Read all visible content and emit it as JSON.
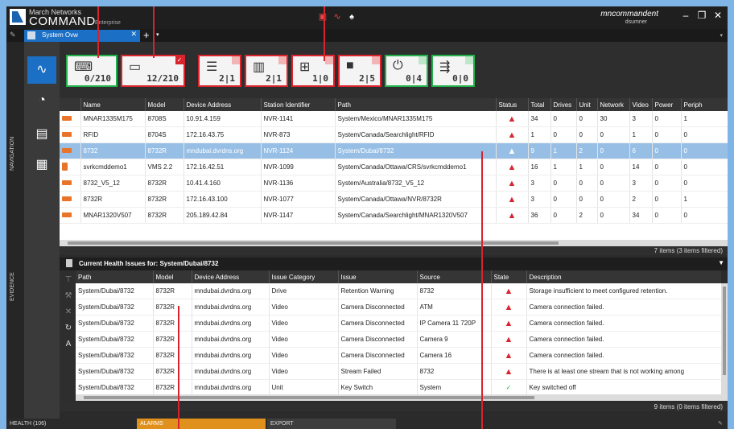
{
  "app": {
    "brand_line1": "March Networks",
    "brand_line2": "COMMAND",
    "brand_line3": "Enterprise",
    "user_name": "mncommandent",
    "user_login": "dsumner"
  },
  "tabs": [
    {
      "label": "System Ovw"
    }
  ],
  "side": {
    "navigation_label": "NAVIGATION",
    "evidence_label": "EVIDENCE"
  },
  "tiles": [
    {
      "icon": "network-icon",
      "count": "0/210",
      "status": "ok"
    },
    {
      "icon": "recorder-icon",
      "count": "12/210",
      "status": "alert",
      "checked": true
    },
    {
      "icon": "database-icon",
      "count": "2|1",
      "status": "alert"
    },
    {
      "icon": "server-icon",
      "count": "2|1",
      "status": "alert"
    },
    {
      "icon": "hierarchy-icon",
      "count": "1|0",
      "status": "alert"
    },
    {
      "icon": "camera-icon",
      "count": "2|5",
      "status": "alert"
    },
    {
      "icon": "power-icon",
      "count": "0|4",
      "status": "ok"
    },
    {
      "icon": "usb-icon",
      "count": "0|0",
      "status": "ok"
    }
  ],
  "devices": {
    "columns": [
      "Name",
      "Model",
      "Device Address",
      "Station Identifier",
      "Path",
      "Status",
      "Total",
      "Drives",
      "Unit",
      "Network",
      "Video",
      "Power",
      "Periph"
    ],
    "rows": [
      {
        "icon": "flat",
        "name": "MNAR1335M175",
        "model": "8708S",
        "address": "10.91.4.159",
        "station": "NVR-1141",
        "path": "System/Mexico/MNAR1335M175",
        "total": "34",
        "drives": "0",
        "unit": "0",
        "network": "30",
        "video": "3",
        "power": "0",
        "periph": "1"
      },
      {
        "icon": "flat",
        "name": "RFID",
        "model": "8704S",
        "address": "172.16.43.75",
        "station": "NVR-873",
        "path": "System/Canada/Searchlight/RFID",
        "total": "1",
        "drives": "0",
        "unit": "0",
        "network": "0",
        "video": "1",
        "power": "0",
        "periph": "0"
      },
      {
        "icon": "flat",
        "name": "8732",
        "model": "8732R",
        "address": "mndubai.dvrdns.org",
        "station": "NVR-1124",
        "path": "System/Dubai/8732",
        "total": "9",
        "drives": "1",
        "unit": "2",
        "network": "0",
        "video": "6",
        "power": "0",
        "periph": "0",
        "selected": true
      },
      {
        "icon": "tall",
        "name": "svrkcmddemo1",
        "model": "VMS 2.2",
        "address": "172.16.42.51",
        "station": "NVR-1099",
        "path": "System/Canada/Ottawa/CRS/svrkcmddemo1",
        "total": "16",
        "drives": "1",
        "unit": "1",
        "network": "0",
        "video": "14",
        "power": "0",
        "periph": "0"
      },
      {
        "icon": "flat",
        "name": "8732_V5_12",
        "model": "8732R",
        "address": "10.41.4.160",
        "station": "NVR-1136",
        "path": "System/Australia/8732_V5_12",
        "total": "3",
        "drives": "0",
        "unit": "0",
        "network": "0",
        "video": "3",
        "power": "0",
        "periph": "0"
      },
      {
        "icon": "flat",
        "name": "8732R",
        "model": "8732R",
        "address": "172.16.43.100",
        "station": "NVR-1077",
        "path": "System/Canada/Ottawa/NVR/8732R",
        "total": "3",
        "drives": "0",
        "unit": "0",
        "network": "0",
        "video": "2",
        "power": "0",
        "periph": "1"
      },
      {
        "icon": "flat",
        "name": "MNAR1320V507",
        "model": "8732R",
        "address": "205.189.42.84",
        "station": "NVR-1147",
        "path": "System/Canada/Searchlight/MNAR1320V507",
        "total": "36",
        "drives": "0",
        "unit": "2",
        "network": "0",
        "video": "34",
        "power": "0",
        "periph": "0"
      }
    ],
    "count_label": "7 items (3 items filtered)"
  },
  "issues": {
    "header": "Current Health Issues for:  System/Dubai/8732",
    "columns": [
      "Path",
      "Model",
      "Device Address",
      "Issue Category",
      "Issue",
      "Source",
      "State",
      "Description"
    ],
    "rows": [
      {
        "path": "System/Dubai/8732",
        "model": "8732R",
        "address": "mndubai.dvrdns.org",
        "category": "Drive",
        "issue": "Retention Warning",
        "source": "8732",
        "state": "warn",
        "description": "Storage insufficient to meet configured retention."
      },
      {
        "path": "System/Dubai/8732",
        "model": "8732R",
        "address": "mndubai.dvrdns.org",
        "category": "Video",
        "issue": "Camera Disconnected",
        "source": "ATM",
        "state": "warn",
        "description": "Camera connection failed."
      },
      {
        "path": "System/Dubai/8732",
        "model": "8732R",
        "address": "mndubai.dvrdns.org",
        "category": "Video",
        "issue": "Camera Disconnected",
        "source": "IP Camera 11 720P",
        "state": "warn",
        "description": "Camera connection failed."
      },
      {
        "path": "System/Dubai/8732",
        "model": "8732R",
        "address": "mndubai.dvrdns.org",
        "category": "Video",
        "issue": "Camera Disconnected",
        "source": "Camera 9",
        "state": "warn",
        "description": "Camera connection failed."
      },
      {
        "path": "System/Dubai/8732",
        "model": "8732R",
        "address": "mndubai.dvrdns.org",
        "category": "Video",
        "issue": "Camera Disconnected",
        "source": "Camera 16",
        "state": "warn",
        "description": "Camera connection failed."
      },
      {
        "path": "System/Dubai/8732",
        "model": "8732R",
        "address": "mndubai.dvrdns.org",
        "category": "Video",
        "issue": "Stream Failed",
        "source": "8732",
        "state": "warn",
        "description": "There is at least one stream that is not working among"
      },
      {
        "path": "System/Dubai/8732",
        "model": "8732R",
        "address": "mndubai.dvrdns.org",
        "category": "Unit",
        "issue": "Key Switch",
        "source": "System",
        "state": "ok",
        "description": "Key switched off"
      }
    ],
    "count_label": "9 items (0 items filtered)"
  },
  "bottom": {
    "health": "HEALTH (106)",
    "alarms": "ALARMS",
    "export": "EXPORT"
  },
  "colors": {
    "accent": "#1b6fc4",
    "alert": "#d9232d",
    "ok": "#22b04a",
    "alarm_tab": "#e0901d"
  }
}
